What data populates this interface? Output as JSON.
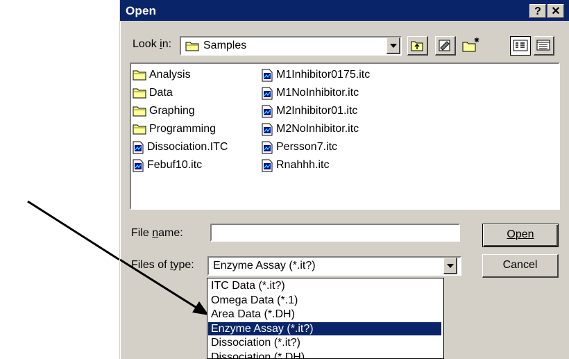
{
  "dialog": {
    "title": "Open",
    "help_button": "?",
    "close_button": "✕"
  },
  "look_in": {
    "label": "Look in:",
    "value": "Samples"
  },
  "toolbar": {
    "icons": [
      "up-one-level-icon",
      "favorites-icon",
      "create-new-folder-icon",
      "list-view-icon",
      "details-view-icon"
    ]
  },
  "files": {
    "column1": [
      {
        "name": "Analysis",
        "type": "folder"
      },
      {
        "name": "Data",
        "type": "folder"
      },
      {
        "name": "Graphing",
        "type": "folder"
      },
      {
        "name": "Programming",
        "type": "folder"
      },
      {
        "name": "Dissociation.ITC",
        "type": "file"
      },
      {
        "name": "Febuf10.itc",
        "type": "file"
      }
    ],
    "column2": [
      {
        "name": "M1Inhibitor0175.itc",
        "type": "file"
      },
      {
        "name": "M1NoInhibitor.itc",
        "type": "file"
      },
      {
        "name": "M2Inhibitor01.itc",
        "type": "file"
      },
      {
        "name": "M2NoInhibitor.itc",
        "type": "file"
      },
      {
        "name": "Persson7.itc",
        "type": "file"
      },
      {
        "name": "Rnahhh.itc",
        "type": "file"
      }
    ]
  },
  "file_name": {
    "label": "File name:",
    "value": ""
  },
  "files_of_type": {
    "label": "Files of type:",
    "value": "Enzyme Assay (*.it?)",
    "options": [
      "ITC Data (*.it?)",
      "Omega Data (*.1)",
      "Area Data (*.DH)",
      "Enzyme Assay (*.it?)",
      "Dissociation (*.it?)",
      "Dissociation (*.DH)"
    ],
    "selected_index": 3
  },
  "buttons": {
    "open": "Open",
    "cancel": "Cancel"
  },
  "colors": {
    "titlebar": "#0a246a",
    "dialog_face": "#d4d0c8",
    "selection": "#0a246a",
    "folder": "#ffff99"
  }
}
